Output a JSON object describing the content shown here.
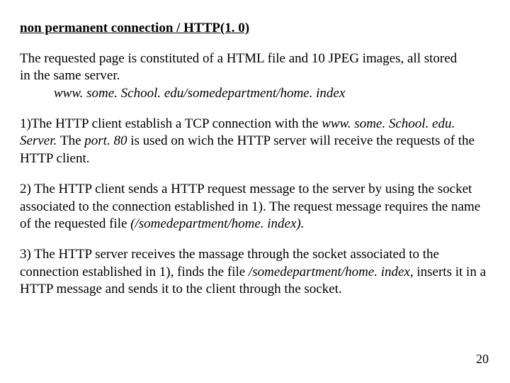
{
  "title": "non permanent connection / HTTP(1. 0)",
  "intro_line1": "The requested page is constituted of a HTML file and 10 JPEG images, all stored",
  "intro_line2": "in the same server.",
  "intro_url": "www. some. School. edu/somedepartment/home. index",
  "p1_a": "1)The HTTP client establish a TCP connection with the ",
  "p1_i1": "www. some. School. edu. Server. ",
  "p1_b": "The ",
  "p1_i2": "port. 80 ",
  "p1_c": "is used on wich the HTTP server will receive the requests of the HTTP client.",
  "p2_a": "2) The HTTP client sends a  HTTP request message to the server by using the socket associated to the connection established in 1).  The request message requires the name of the requested file ",
  "p2_i": "(/somedepartment/home. index).",
  "p3_a": "3) The HTTP server receives the massage through the socket associated to the connection established in 1), finds the file ",
  "p3_i": "/somedepartment/home. index, ",
  "p3_b": "inserts it in a HTTP message and sends it to the client through the socket.",
  "page_number": "20"
}
